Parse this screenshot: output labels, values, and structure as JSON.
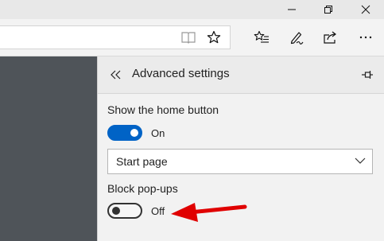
{
  "panel": {
    "title": "Advanced settings",
    "home_button": {
      "label": "Show the home button",
      "toggle_state": "On"
    },
    "home_page_select": {
      "selected": "Start page"
    },
    "popups": {
      "label": "Block pop-ups",
      "toggle_state": "Off"
    }
  },
  "icons": {
    "titlebar": [
      "minimize-icon",
      "restore-icon",
      "close-icon"
    ],
    "address": [
      "reading-view-icon",
      "favorite-star-icon"
    ],
    "toolbar": [
      "favorites-hub-icon",
      "web-note-icon",
      "share-icon",
      "more-icon"
    ],
    "panel": [
      "back-chevron-icon",
      "pin-icon",
      "dropdown-chevron-icon"
    ]
  },
  "colors": {
    "toggle_on": "#0063c6",
    "arrow": "#e00000",
    "page_background": "#4f5459"
  }
}
